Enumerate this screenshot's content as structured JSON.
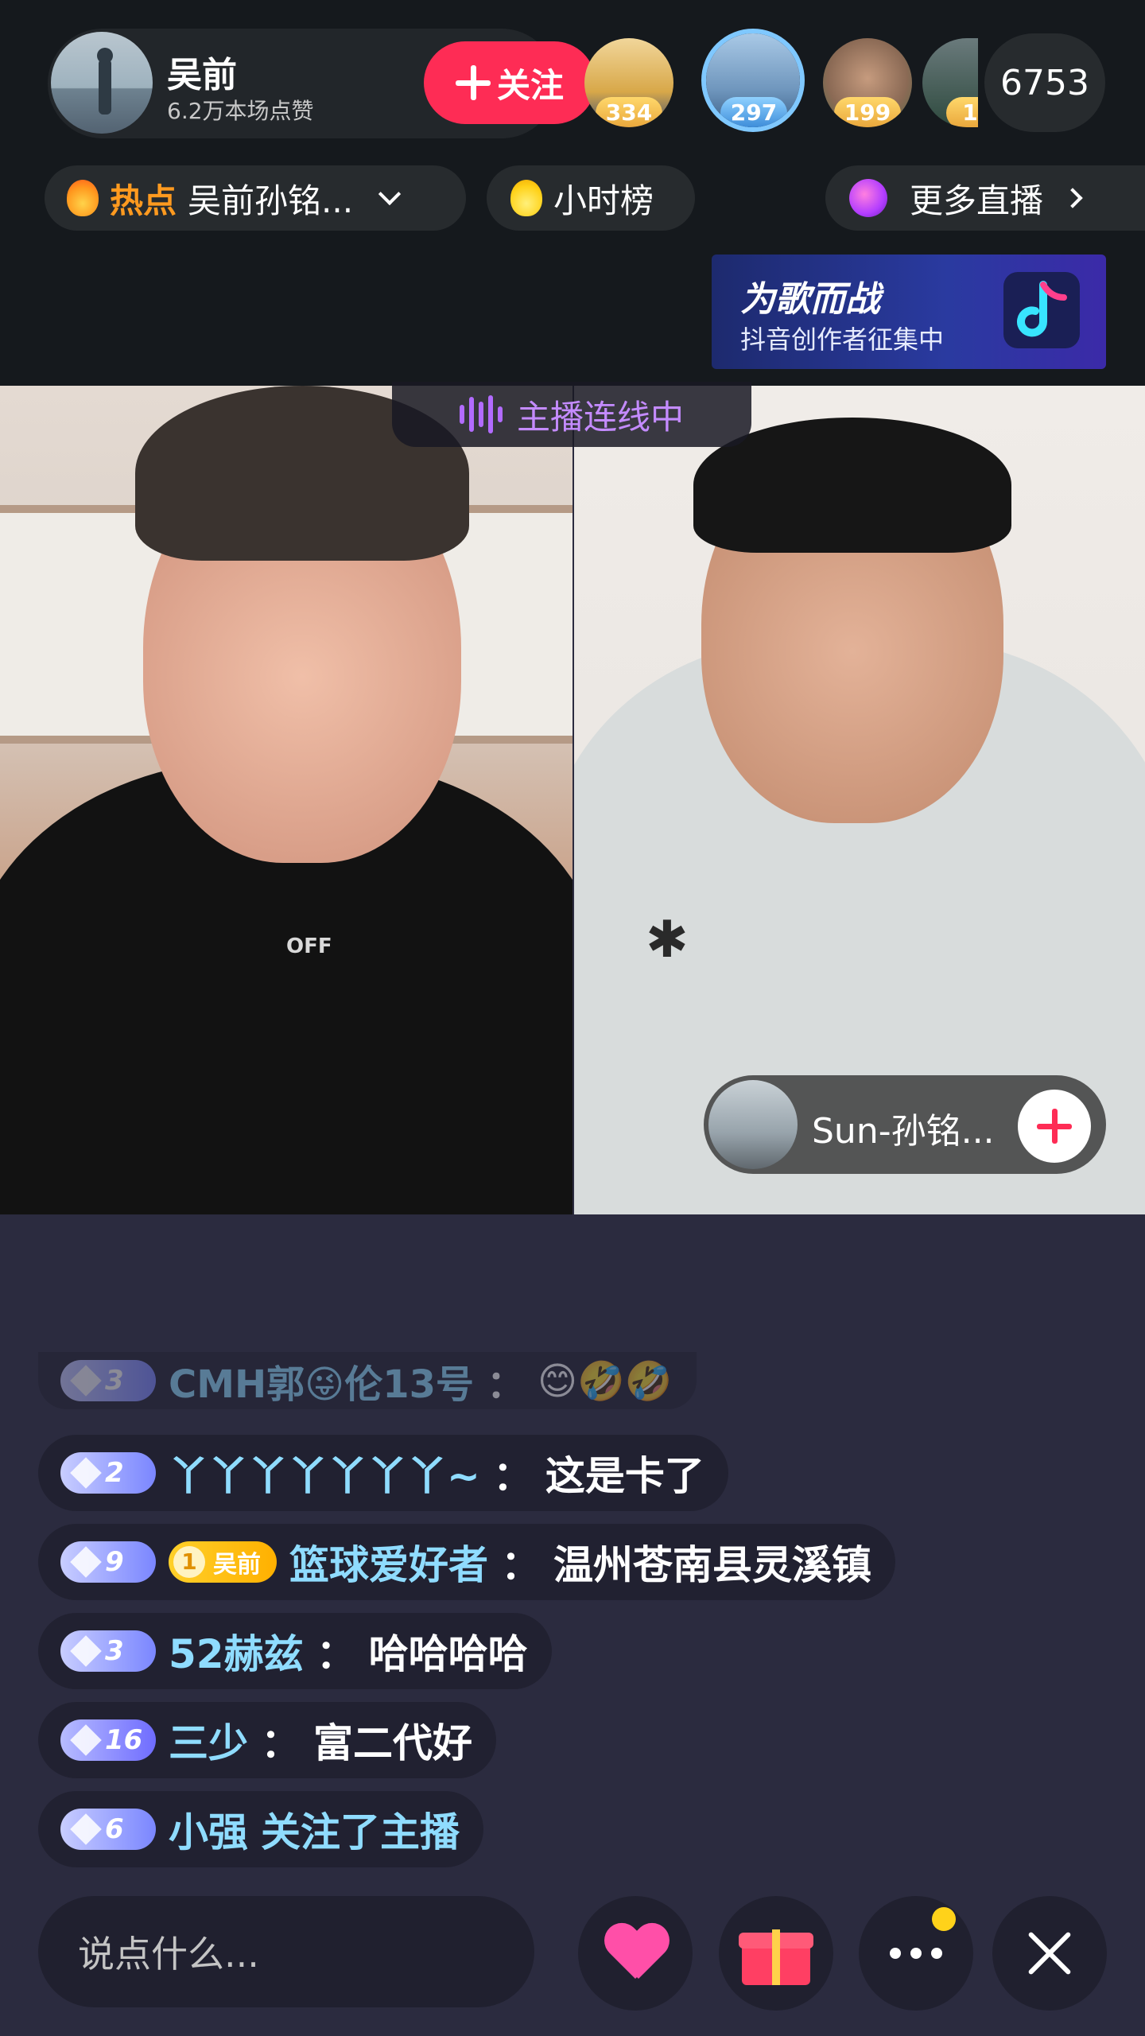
{
  "header": {
    "host_name": "吴前",
    "host_likes": "6.2万本场点赞",
    "follow_label": "关注",
    "viewers": [
      {
        "badge": "334"
      },
      {
        "badge": "297"
      },
      {
        "badge": "199"
      },
      {
        "badge": "1"
      }
    ],
    "viewer_count": "6753"
  },
  "pills": {
    "hot_label": "热点",
    "hot_topic": "吴前孙铭...",
    "hourly_rank": "小时榜",
    "more_live": "更多直播"
  },
  "banner": {
    "title": "为歌而战",
    "subtitle": "抖音创作者征集中"
  },
  "live": {
    "connect_status": "主播连线中",
    "guest_name": "Sun-孙铭...",
    "shirt_text": "OFF"
  },
  "chat": {
    "messages": [
      {
        "level": "3",
        "user": "CMH郭😜伦13号",
        "text": "😊🤣🤣"
      },
      {
        "level": "2",
        "user": "丫丫丫丫丫丫丫~",
        "text": "这是卡了"
      },
      {
        "level": "9",
        "fan_level": "1",
        "fan_name": "吴前",
        "user": "篮球爱好者",
        "text": "温州苍南县灵溪镇"
      },
      {
        "level": "3",
        "user": "52赫兹",
        "text": "哈哈哈哈"
      },
      {
        "level": "16",
        "user": "三少",
        "text": "富二代好"
      },
      {
        "level": "6",
        "user": "小强",
        "text": "关注了主播"
      }
    ]
  },
  "bottom_bar": {
    "input_placeholder": "说点什么..."
  },
  "colors": {
    "accent": "#fe2c55",
    "username": "#8fdcff",
    "connect": "#c48bff"
  }
}
